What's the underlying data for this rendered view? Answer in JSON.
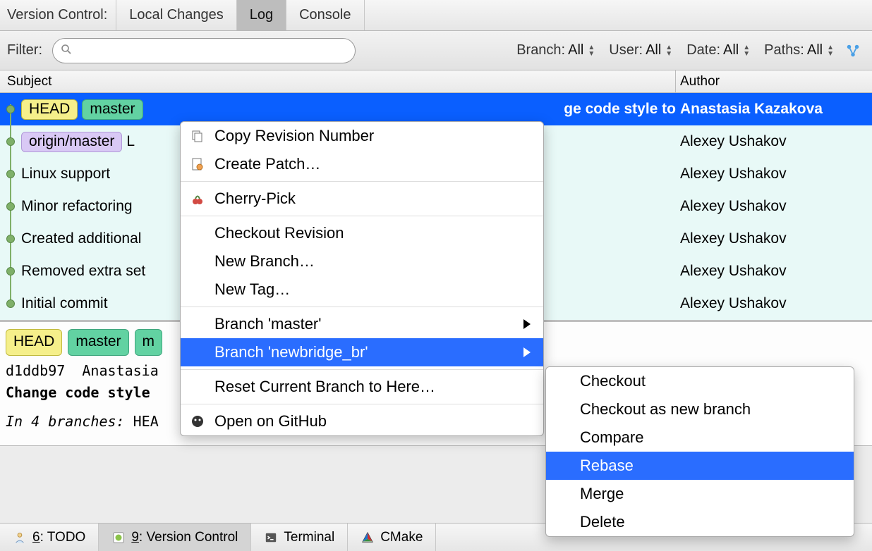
{
  "panel_title": "Version Control:",
  "tabs": {
    "local_changes": "Local Changes",
    "log": "Log",
    "console": "Console"
  },
  "filter": {
    "label": "Filter:",
    "branch_label": "Branch:",
    "branch_value": "All",
    "user_label": "User:",
    "user_value": "All",
    "date_label": "Date:",
    "date_value": "All",
    "paths_label": "Paths:",
    "paths_value": "All"
  },
  "columns": {
    "subject": "Subject",
    "author": "Author"
  },
  "commits": [
    {
      "subject_suffix": "ge code style to",
      "author": "Anastasia Kazakova",
      "tags": [
        "HEAD",
        "master"
      ]
    },
    {
      "subject_prefix": "L",
      "author": "Alexey Ushakov",
      "tags": [
        "origin/master"
      ]
    },
    {
      "subject": "Linux support",
      "author": "Alexey Ushakov"
    },
    {
      "subject": "Minor refactoring",
      "author": "Alexey Ushakov"
    },
    {
      "subject": "Created additional",
      "author": "Alexey Ushakov"
    },
    {
      "subject": "Removed extra set",
      "author": "Alexey Ushakov"
    },
    {
      "subject": "Initial commit",
      "author": "Alexey Ushakov"
    }
  ],
  "details": {
    "tags": {
      "head": "HEAD",
      "master": "master",
      "extra": "m"
    },
    "hash": "d1ddb97",
    "author": "Anastasia",
    "subject": "Change code style",
    "branches_label": "In 4 branches:",
    "branches_value": "HEA"
  },
  "bottom": {
    "todo": "6: TODO",
    "todo_key": "6",
    "vc": "9: Version Control",
    "vc_key": "9",
    "terminal": "Terminal",
    "cmake": "CMake"
  },
  "context_menu": {
    "copy_revision": "Copy Revision Number",
    "create_patch": "Create Patch…",
    "cherry_pick": "Cherry-Pick",
    "checkout_revision": "Checkout Revision",
    "new_branch": "New Branch…",
    "new_tag": "New Tag…",
    "branch_master": "Branch 'master'",
    "branch_newbridge": "Branch 'newbridge_br'",
    "reset": "Reset Current Branch to Here…",
    "open_github": "Open on GitHub"
  },
  "submenu": {
    "checkout": "Checkout",
    "checkout_new": "Checkout as new branch",
    "compare": "Compare",
    "rebase": "Rebase",
    "merge": "Merge",
    "delete": "Delete"
  }
}
